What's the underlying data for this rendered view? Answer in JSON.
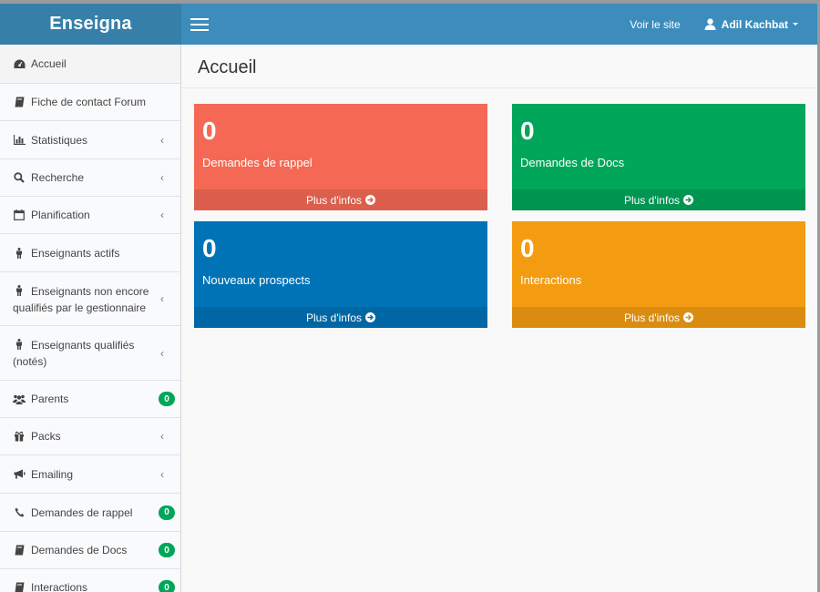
{
  "app": {
    "logo": "Enseigna"
  },
  "navbar": {
    "site_link": "Voir le site",
    "user_name": "Adil Kachbat"
  },
  "page": {
    "title": "Accueil"
  },
  "colors": {
    "red": "#f56954",
    "green": "#00a65a",
    "blue": "#0073b7",
    "orange": "#f39c12",
    "navbar": "#3c8dbc",
    "logo_bg": "#367fa9"
  },
  "sidebar": {
    "items": [
      {
        "label": "Accueil",
        "icon": "dashboard-icon"
      },
      {
        "label": "Fiche de contact Forum",
        "icon": "book-icon"
      },
      {
        "label": "Statistiques",
        "icon": "bar-chart-icon"
      },
      {
        "label": "Recherche",
        "icon": "search-icon"
      },
      {
        "label": "Planification",
        "icon": "calendar-icon"
      },
      {
        "label": "Enseignants actifs",
        "icon": "male-icon"
      },
      {
        "label": "Enseignants non encore qualifiés par le gestionnaire",
        "icon": "male-icon"
      },
      {
        "label": "Enseignants qualifiés (notés)",
        "icon": "male-icon"
      },
      {
        "label": "Parents",
        "icon": "users-icon",
        "badge": "0"
      },
      {
        "label": "Packs",
        "icon": "gift-icon"
      },
      {
        "label": "Emailing",
        "icon": "bullhorn-icon"
      },
      {
        "label": "Demandes de rappel",
        "icon": "phone-icon",
        "badge": "0"
      },
      {
        "label": "Demandes de Docs",
        "icon": "book-icon",
        "badge": "0"
      },
      {
        "label": "Interactions",
        "icon": "book-icon",
        "badge": "0"
      }
    ]
  },
  "boxes": [
    {
      "value": "0",
      "label": "Demandes de rappel",
      "more": "Plus d'infos"
    },
    {
      "value": "0",
      "label": "Demandes de Docs",
      "more": "Plus d'infos"
    },
    {
      "value": "0",
      "label": "Nouveaux prospects",
      "more": "Plus d'infos"
    },
    {
      "value": "0",
      "label": "Interactions",
      "more": "Plus d'infos"
    }
  ]
}
